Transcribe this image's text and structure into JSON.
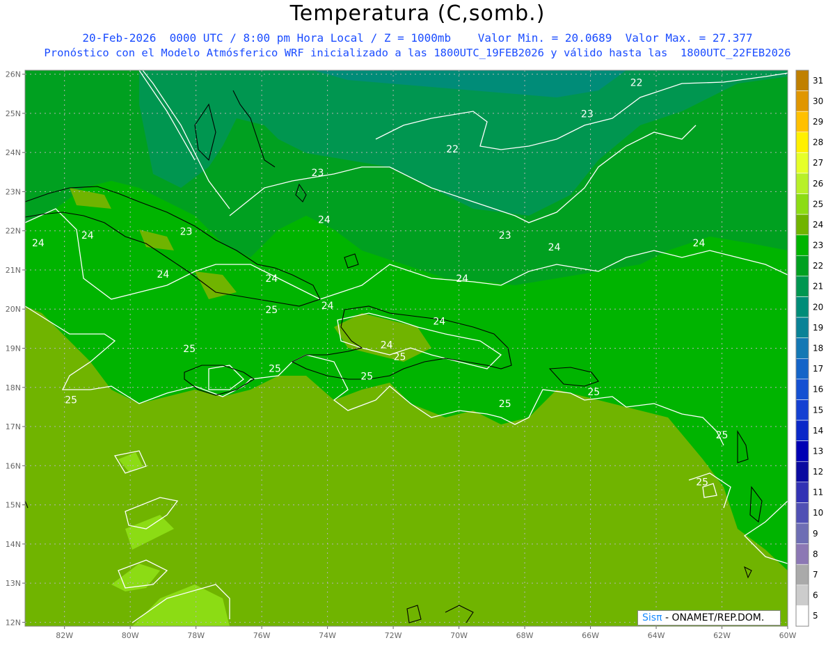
{
  "header": {
    "title": "Temperatura (C,somb.)",
    "line1": "20-Feb-2026  0000 UTC / 8:00 pm Hora Local / Z = 1000mb    Valor Min. = 20.0689  Valor Max. = 27.377",
    "line2": "Pronóstico con el Modelo Atmósferico WRF inicializado a las 1800UTC_19FEB2026 y válido hasta las  1800UTC_22FEB2026"
  },
  "axes": {
    "lat_labels": [
      "26N",
      "25N",
      "24N",
      "23N",
      "22N",
      "21N",
      "20N",
      "19N",
      "18N",
      "17N",
      "16N",
      "15N",
      "14N",
      "13N",
      "12N"
    ],
    "lon_labels": [
      "82W",
      "80W",
      "78W",
      "76W",
      "74W",
      "72W",
      "70W",
      "68W",
      "66W",
      "64W",
      "62W",
      "60W"
    ]
  },
  "contour_labels": [
    {
      "text": "22",
      "lon": -64.6,
      "lat": 25.7
    },
    {
      "text": "22",
      "lon": -70.2,
      "lat": 24.0
    },
    {
      "text": "23",
      "lon": -66.1,
      "lat": 24.9
    },
    {
      "text": "23",
      "lon": -74.3,
      "lat": 23.4
    },
    {
      "text": "23",
      "lon": -78.3,
      "lat": 21.9
    },
    {
      "text": "23",
      "lon": -68.6,
      "lat": 21.8
    },
    {
      "text": "24",
      "lon": -74.1,
      "lat": 22.2
    },
    {
      "text": "24",
      "lon": -82.8,
      "lat": 21.6
    },
    {
      "text": "24",
      "lon": -81.3,
      "lat": 21.8
    },
    {
      "text": "24",
      "lon": -79.0,
      "lat": 20.8
    },
    {
      "text": "24",
      "lon": -75.7,
      "lat": 20.7
    },
    {
      "text": "24",
      "lon": -74.0,
      "lat": 20.0
    },
    {
      "text": "24",
      "lon": -69.9,
      "lat": 20.7
    },
    {
      "text": "24",
      "lon": -67.1,
      "lat": 21.5
    },
    {
      "text": "24",
      "lon": -62.7,
      "lat": 21.6
    },
    {
      "text": "24",
      "lon": -70.6,
      "lat": 19.6
    },
    {
      "text": "24",
      "lon": -72.2,
      "lat": 19.0
    },
    {
      "text": "25",
      "lon": -75.7,
      "lat": 19.9
    },
    {
      "text": "25",
      "lon": -78.2,
      "lat": 18.9
    },
    {
      "text": "25",
      "lon": -75.6,
      "lat": 18.4
    },
    {
      "text": "25",
      "lon": -71.8,
      "lat": 18.7
    },
    {
      "text": "25",
      "lon": -72.8,
      "lat": 18.2
    },
    {
      "text": "25",
      "lon": -81.8,
      "lat": 17.6
    },
    {
      "text": "25",
      "lon": -68.6,
      "lat": 17.5
    },
    {
      "text": "25",
      "lon": -65.9,
      "lat": 17.8
    },
    {
      "text": "25",
      "lon": -62.0,
      "lat": 16.7
    },
    {
      "text": "25",
      "lon": -62.6,
      "lat": 15.5
    }
  ],
  "colorbar": {
    "labels": [
      "31",
      "30",
      "29",
      "28",
      "27",
      "26",
      "25",
      "24",
      "23",
      "22",
      "21",
      "20",
      "19",
      "18",
      "17",
      "16",
      "15",
      "14",
      "13",
      "12",
      "11",
      "10",
      "9",
      "8",
      "7",
      "6",
      "5"
    ],
    "colors": [
      "#c08000",
      "#e09600",
      "#ffc000",
      "#fff000",
      "#e6ff28",
      "#b8f028",
      "#8cdc14",
      "#70b400",
      "#00b400",
      "#00a020",
      "#009650",
      "#008c78",
      "#0a8296",
      "#1478b4",
      "#1464c8",
      "#1450d2",
      "#1440d2",
      "#0a28c8",
      "#0000b4",
      "#0a0aa0",
      "#3232b4",
      "#5050b4",
      "#6e6eb4",
      "#8c78b4",
      "#aaaaaa",
      "#cccccc",
      "#ffffff"
    ]
  },
  "credit": {
    "sis": "Sisπ",
    "rest": " - ONAMET/REP.DOM."
  },
  "colors": {
    "title": "#000000",
    "subtitle": "#1a4cff",
    "contour": "#ffffff",
    "coast": "#000000",
    "grid": "#b4b4b4"
  }
}
